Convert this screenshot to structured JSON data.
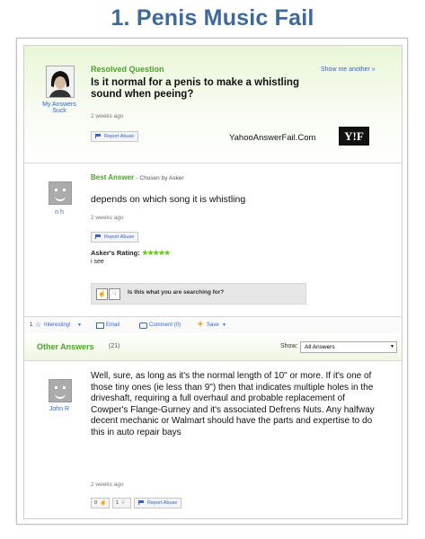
{
  "page_title": "1. Penis Music Fail",
  "question": {
    "header": "Resolved Question",
    "show_another": "Show me another »",
    "asker": "My Answers Suck",
    "text": "Is it normal for a penis to make a whistling sound when peeing?",
    "time": "2 weeks ago",
    "report": "Report Abuse",
    "watermark": "YahooAnswerFail.Com",
    "logo": "Y!F"
  },
  "best_answer": {
    "label": "Best Answer",
    "chosen": "- Chosen by Asker",
    "user": "n h",
    "text": "depends on which song it is whistling",
    "time": "2 weeks ago",
    "report": "Report Abuse",
    "rating_label": "Asker's Rating:",
    "stars": "★★★★★",
    "comment": "i see",
    "search_prompt": "Is this what you are searching for?"
  },
  "actions": {
    "count": "1",
    "interesting": "Interesting!",
    "email": "Email",
    "comment": "Comment (0)",
    "save": "Save"
  },
  "other": {
    "header": "Other Answers",
    "count": "(21)",
    "show_label": "Show:",
    "show_value": "All Answers",
    "user": "John R",
    "text": "Well, sure, as long as it's the normal length of 10\" or more.  If it's one of those tiny ones (ie less than 9\") then that indicates multiple holes in the driveshaft, requiring a full overhaul and probable replacement of Cowper's Flange-Gurney and it's associated Defrens Nuts. Any halfway decent mechanic or Walmart should have the parts and expertise to do this in auto repair bays",
    "time": "2 weeks ago",
    "thumbs_up": "0",
    "thumbs_down": "1",
    "report": "Report Abuse"
  },
  "colors": {
    "title": "#3d6a9a",
    "green": "#4ba32a",
    "link": "#3366cc",
    "star": "#6cc52a"
  }
}
